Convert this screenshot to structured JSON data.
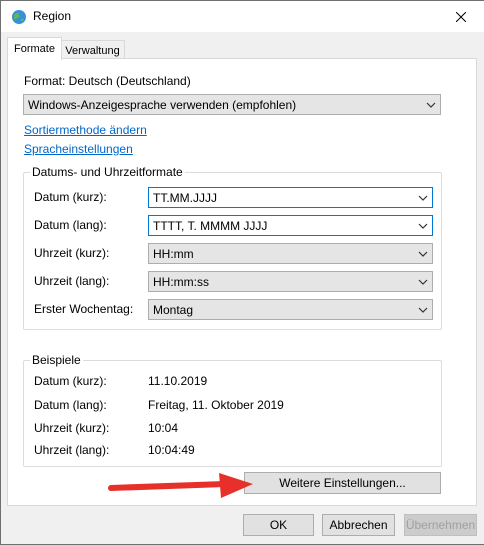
{
  "window": {
    "title": "Region",
    "close_icon": "close-icon",
    "app_icon": "globe-icon"
  },
  "tabs": [
    {
      "label": "Formate",
      "active": true
    },
    {
      "label": "Verwaltung",
      "active": false
    }
  ],
  "format": {
    "label": "Format: Deutsch (Deutschland)",
    "selected": "Windows-Anzeigesprache verwenden (empfohlen)"
  },
  "links": {
    "sort": "Sortiermethode ändern",
    "language": "Spracheinstellungen"
  },
  "datetime_group": {
    "title": "Datums- und Uhrzeitformate",
    "rows": [
      {
        "label": "Datum (kurz):",
        "value": "TT.MM.JJJJ"
      },
      {
        "label": "Datum (lang):",
        "value": "TTTT, T. MMMM JJJJ"
      },
      {
        "label": "Uhrzeit (kurz):",
        "value": "HH:mm"
      },
      {
        "label": "Uhrzeit (lang):",
        "value": "HH:mm:ss"
      },
      {
        "label": "Erster Wochentag:",
        "value": "Montag"
      }
    ]
  },
  "examples_group": {
    "title": "Beispiele",
    "rows": [
      {
        "label": "Datum (kurz):",
        "value": "11.10.2019"
      },
      {
        "label": "Datum (lang):",
        "value": "Freitag, 11. Oktober 2019"
      },
      {
        "label": "Uhrzeit (kurz):",
        "value": "10:04"
      },
      {
        "label": "Uhrzeit (lang):",
        "value": "10:04:49"
      }
    ]
  },
  "buttons": {
    "more_settings": "Weitere Einstellungen...",
    "ok": "OK",
    "cancel": "Abbrechen",
    "apply": "Übernehmen"
  },
  "colors": {
    "link": "#0066cc",
    "focus_border": "#0078d7",
    "annotation_arrow": "#e8302a"
  }
}
